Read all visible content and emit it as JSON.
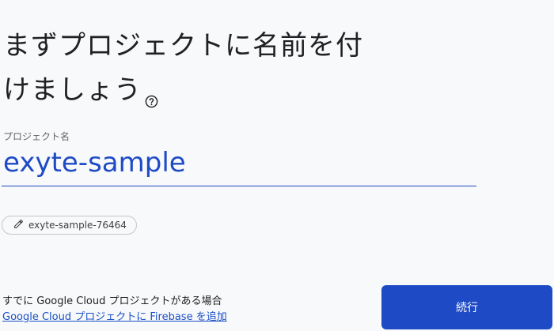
{
  "heading": {
    "line1": "まずプロジェクトに名前を付",
    "line2": "けましょう"
  },
  "project_name": {
    "label": "プロジェクト名",
    "value": "exyte-sample"
  },
  "project_id_chip": {
    "label": "exyte-sample-76464",
    "icon": "pencil-icon"
  },
  "footer": {
    "text": "すでに Google Cloud プロジェクトがある場合",
    "link": "Google Cloud プロジェクトに Firebase を追加"
  },
  "continue_button": {
    "label": "続行"
  },
  "colors": {
    "accent": "#1e4ac6",
    "background": "#f8f9fa",
    "text": "#202124"
  }
}
